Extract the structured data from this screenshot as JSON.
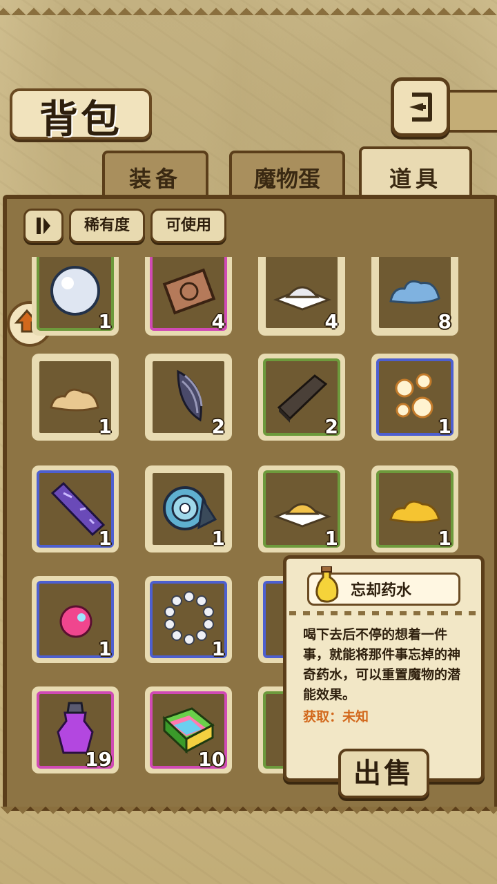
{
  "header": {
    "title": "背包",
    "back_icon": "back-arrow-icon"
  },
  "tabs": [
    {
      "label": "装备",
      "active": false
    },
    {
      "label": "魔物蛋",
      "active": false
    },
    {
      "label": "道具",
      "active": true
    }
  ],
  "filters": {
    "sort_icon": "sort-toggle-icon",
    "rarity": "稀有度",
    "usable": "可使用"
  },
  "items": [
    {
      "icon": "pearl-orb-icon",
      "count": "1",
      "rarity": "green"
    },
    {
      "icon": "rune-card-icon",
      "count": "4",
      "rarity": "pink"
    },
    {
      "icon": "white-powder-icon",
      "count": "4",
      "rarity": "white"
    },
    {
      "icon": "blue-slime-icon",
      "count": "8",
      "rarity": "white"
    },
    {
      "icon": "sand-pile-icon",
      "count": "1",
      "rarity": "white"
    },
    {
      "icon": "striped-seed-icon",
      "count": "2",
      "rarity": "white"
    },
    {
      "icon": "dark-wood-plank-icon",
      "count": "2",
      "rarity": "green"
    },
    {
      "icon": "spirit-wisps-icon",
      "count": "1",
      "rarity": "blue"
    },
    {
      "icon": "crystal-bar-icon",
      "count": "1",
      "rarity": "blue"
    },
    {
      "icon": "spiral-shell-icon",
      "count": "1",
      "rarity": "white"
    },
    {
      "icon": "yellow-powder-icon",
      "count": "1",
      "rarity": "green"
    },
    {
      "icon": "gold-slime-icon",
      "count": "1",
      "rarity": "green"
    },
    {
      "icon": "pink-orb-icon",
      "count": "1",
      "rarity": "blue"
    },
    {
      "icon": "pearl-necklace-icon",
      "count": "1",
      "rarity": "blue"
    },
    {
      "icon": "hidden-item-icon",
      "count": "",
      "rarity": "blue"
    },
    {
      "icon": "",
      "count": "",
      "rarity": "white"
    },
    {
      "icon": "purple-potion-icon",
      "count": "19",
      "rarity": "pink"
    },
    {
      "icon": "rainbow-box-icon",
      "count": "10",
      "rarity": "pink"
    },
    {
      "icon": "hidden-item-icon",
      "count": "",
      "rarity": "green"
    },
    {
      "icon": "",
      "count": "",
      "rarity": "white"
    }
  ],
  "tooltip": {
    "name": "忘却药水",
    "icon": "forget-potion-icon",
    "description": "喝下去后不停的想着一件事，就能将那件事忘掉的神奇药水，可以重置魔物的潜能效果。",
    "source": "获取：未知",
    "sell_label": "出售"
  },
  "colors": {
    "green": "#6d9a3c",
    "blue": "#4d5fd0",
    "pink": "#d04ab5",
    "source_text": "#d2681c"
  }
}
